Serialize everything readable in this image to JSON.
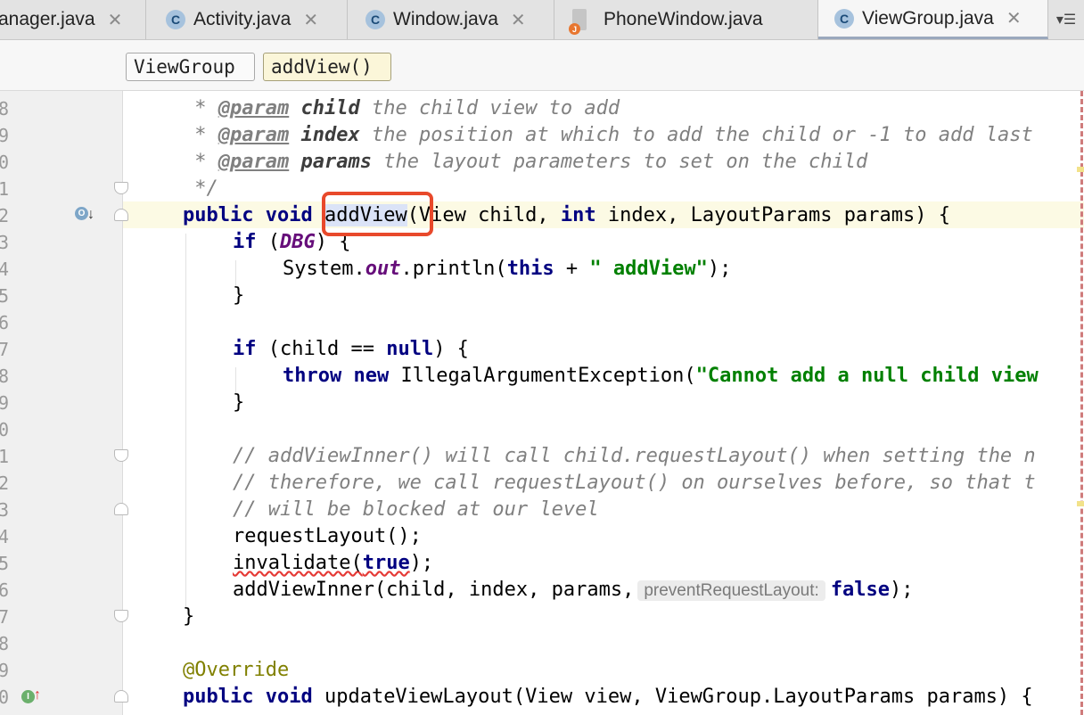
{
  "tabs": [
    {
      "label": "anager.java",
      "icon": "",
      "active": false
    },
    {
      "label": "Activity.java",
      "icon": "C",
      "active": false
    },
    {
      "label": "Window.java",
      "icon": "C",
      "active": false
    },
    {
      "label": "PhoneWindow.java",
      "icon": "J",
      "active": false
    },
    {
      "label": "ViewGroup.java",
      "icon": "C",
      "active": true
    }
  ],
  "tab_close_glyph": "✕",
  "tab_menu_glyph": "▾☰",
  "breadcrumb": {
    "class_name": "ViewGroup",
    "method_name": "addView()"
  },
  "gutter_line_digits": [
    "8",
    "9",
    "0",
    "1",
    "2",
    "3",
    "4",
    "5",
    "6",
    "7",
    "8",
    "9",
    "0",
    "1",
    "2",
    "3",
    "4",
    "5",
    "6",
    "7",
    "8",
    "9",
    "0"
  ],
  "gutter_icons": {
    "override": "O",
    "implemented": "I"
  },
  "code": {
    "l0_star": " * ",
    "l0_tag": "@param",
    "l0_name": "child",
    "l0_text": " the child view to add",
    "l1_star": " * ",
    "l1_tag": "@param",
    "l1_name": "index",
    "l1_text": " the position at which to add the child or -1 to add last",
    "l2_star": " * ",
    "l2_tag": "@param",
    "l2_name": "params",
    "l2_text": " the layout parameters to set on the child",
    "l3": " */",
    "l4_kw1": "public",
    "l4_kw2": "void",
    "l4_method": "addView",
    "l4_p1": "(View child, ",
    "l4_kw3": "int",
    "l4_p2": " index, LayoutParams params) {",
    "l5_kw": "if",
    "l5_a": " (",
    "l5_field": "DBG",
    "l5_b": ") {",
    "l6_a": "System.",
    "l6_field": "out",
    "l6_b": ".println(",
    "l6_kw": "this",
    "l6_c": " + ",
    "l6_str": "\" addView\"",
    "l6_d": ");",
    "l7": "}",
    "l9_kw": "if",
    "l9_a": " (child == ",
    "l9_kw2": "null",
    "l9_b": ") {",
    "l10_kw1": "throw",
    "l10_kw2": "new",
    "l10_a": " IllegalArgumentException(",
    "l10_str": "\"Cannot add a null child view",
    "l11": "}",
    "l13": "// addViewInner() will call child.requestLayout() when setting the n",
    "l14": "// therefore, we call requestLayout() on ourselves before, so that t",
    "l15": "// will be blocked at our level",
    "l16": "requestLayout();",
    "l17_a": "invalidate(",
    "l17_kw": "true",
    "l17_b": ");",
    "l18_a": "addViewInner(child, index, params,",
    "l18_hint": "preventRequestLayout:",
    "l18_kw": "false",
    "l18_b": ");",
    "l19": "}",
    "l21": "@Override",
    "l22_kw1": "public",
    "l22_kw2": "void",
    "l22_a": " updateViewLayout(View view, ViewGroup.LayoutParams params) {"
  },
  "colors": {
    "keyword": "#000080",
    "string": "#008000",
    "comment": "#808080",
    "field": "#660e7a",
    "annotation": "#808000",
    "callout": "#e8492b",
    "current_line": "#fcfae4"
  }
}
